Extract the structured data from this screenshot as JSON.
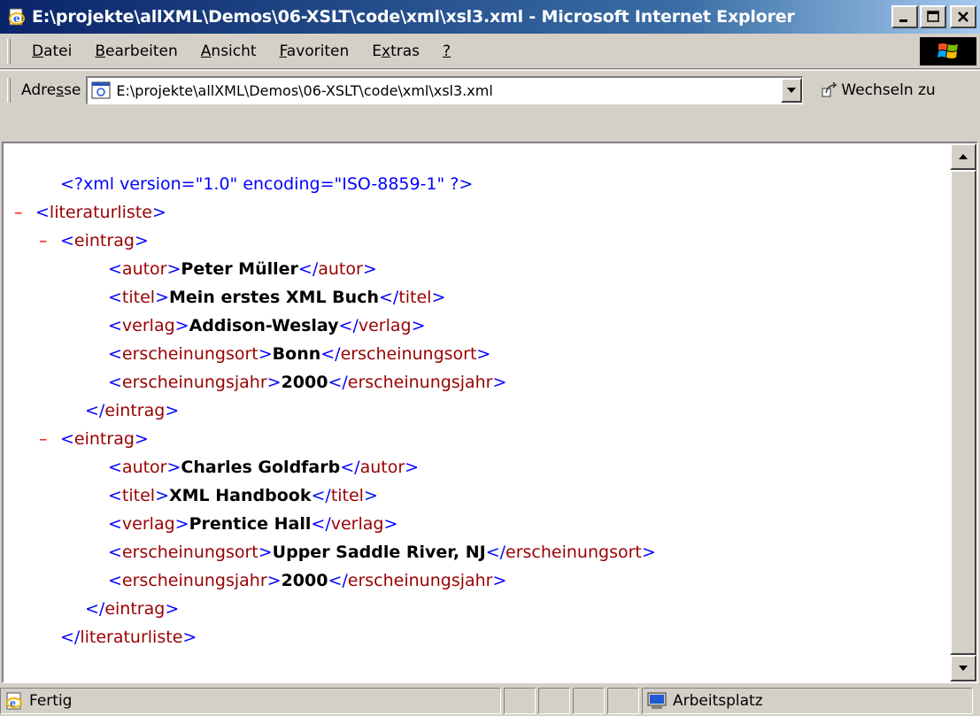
{
  "window": {
    "title": "E:\\projekte\\allXML\\Demos\\06-XSLT\\code\\xml\\xsl3.xml - Microsoft Internet Explorer"
  },
  "menu": {
    "items": [
      {
        "u": "D",
        "rest": "atei"
      },
      {
        "u": "B",
        "rest": "earbeiten"
      },
      {
        "u": "A",
        "rest": "nsicht"
      },
      {
        "u": "F",
        "rest": "avoriten"
      },
      {
        "u": "x",
        "pre": "E",
        "rest": "tras"
      },
      {
        "u": "?",
        "rest": ""
      }
    ]
  },
  "address": {
    "label_pre": "Adre",
    "label_u": "s",
    "label_post": "se",
    "value": "E:\\projekte\\allXML\\Demos\\06-XSLT\\code\\xml\\xsl3.xml",
    "go_label": "Wechseln zu"
  },
  "document": {
    "pi": "<?xml version=\"1.0\" encoding=\"ISO-8859-1\" ?>",
    "minus": "–",
    "root": "literaturliste",
    "entry": "eintrag",
    "entries": [
      {
        "fields": [
          {
            "name": "autor",
            "value": "Peter Müller"
          },
          {
            "name": "titel",
            "value": "Mein erstes XML Buch"
          },
          {
            "name": "verlag",
            "value": "Addison-Weslay"
          },
          {
            "name": "erscheinungsort",
            "value": "Bonn"
          },
          {
            "name": "erscheinungsjahr",
            "value": "2000"
          }
        ]
      },
      {
        "fields": [
          {
            "name": "autor",
            "value": "Charles Goldfarb"
          },
          {
            "name": "titel",
            "value": "XML Handbook"
          },
          {
            "name": "verlag",
            "value": "Prentice Hall"
          },
          {
            "name": "erscheinungsort",
            "value": "Upper Saddle River, NJ"
          },
          {
            "name": "erscheinungsjahr",
            "value": "2000"
          }
        ]
      }
    ]
  },
  "status": {
    "text": "Fertig",
    "zone": "Arbeitsplatz"
  },
  "colors": {
    "titlebar": "#0a246a",
    "tag": "#0000ff",
    "element_name": "#990000",
    "minus": "#ff0000"
  }
}
